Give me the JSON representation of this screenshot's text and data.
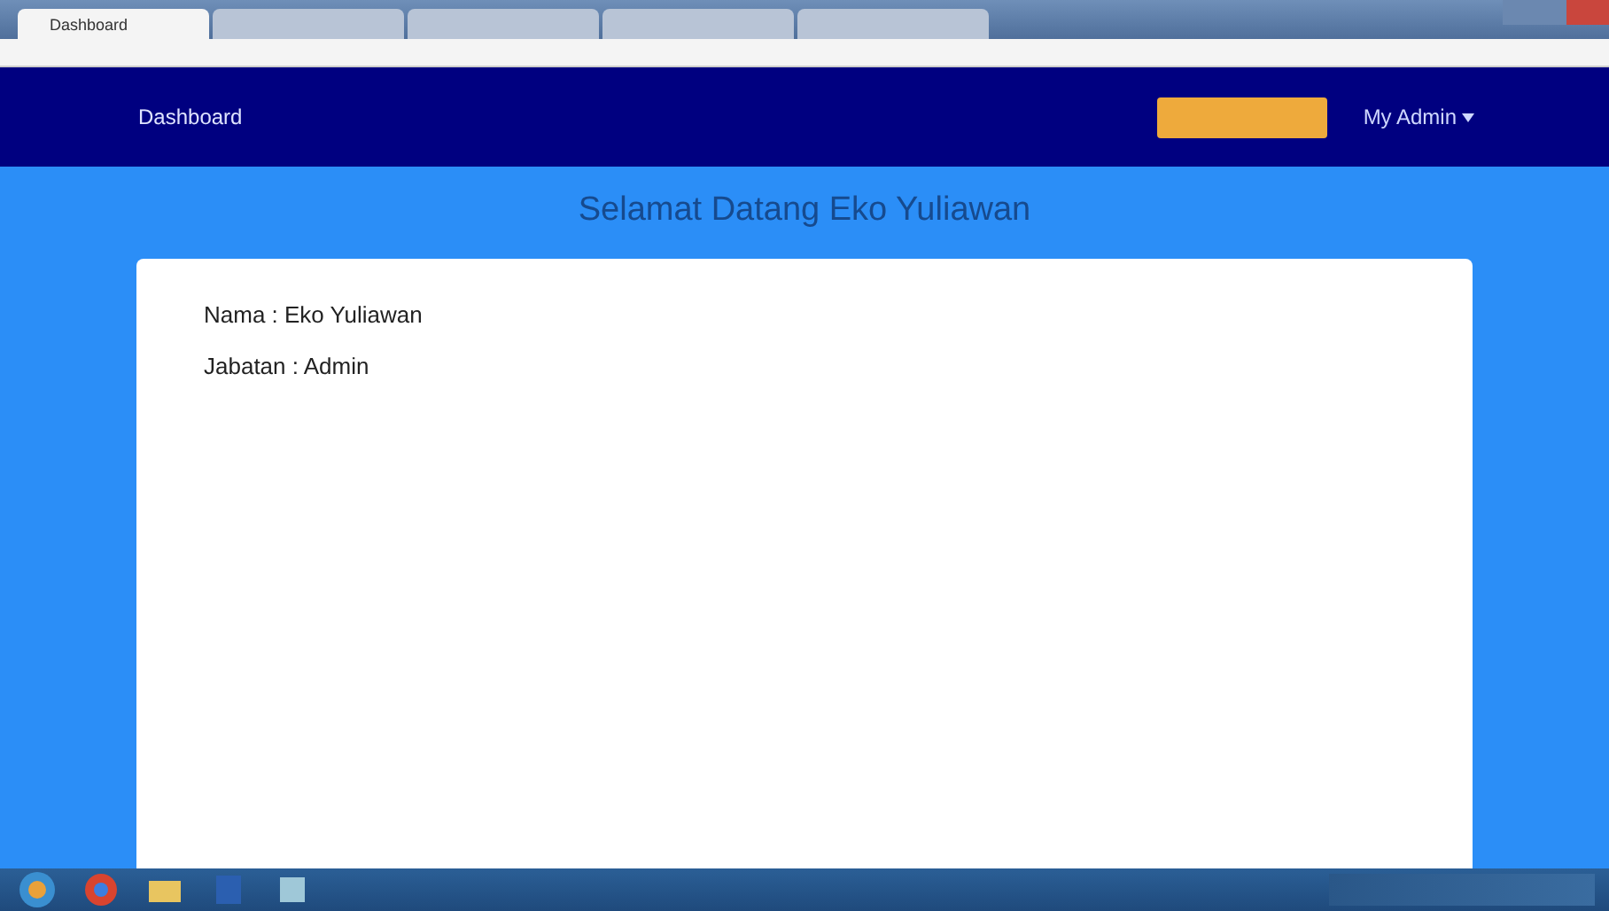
{
  "browser": {
    "tabs": [
      {
        "title": "Dashboard",
        "selected": true
      },
      {
        "selected": false
      },
      {
        "selected": false
      },
      {
        "selected": false
      },
      {
        "selected": false
      }
    ]
  },
  "navbar": {
    "brand": "Dashboard",
    "user_menu": "My Admin"
  },
  "heading": "Selamat Datang Eko Yuliawan",
  "profile": [
    "Nama : Eko Yuliawan",
    "Jabatan : Admin"
  ]
}
